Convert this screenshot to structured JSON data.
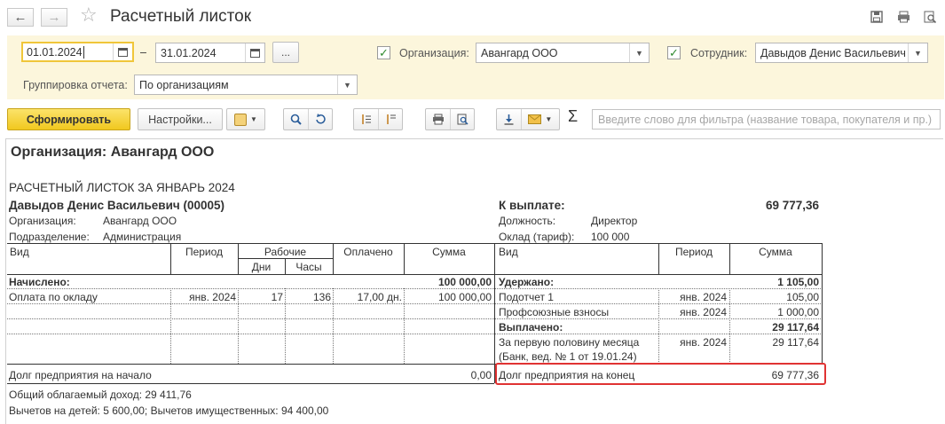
{
  "window": {
    "title": "Расчетный листок",
    "nav_back_icon": "arrow-left-icon",
    "nav_forward_icon": "arrow-right-icon",
    "favorite_icon": "star-icon"
  },
  "filters": {
    "date_from": "01.01.2024",
    "date_separator": "–",
    "date_to": "31.01.2024",
    "period_button": "...",
    "organization_label": "Организация:",
    "organization_value": "Авангард ООО",
    "employee_label": "Сотрудник:",
    "employee_value": "Давыдов Денис Васильевич",
    "grouping_label": "Группировка отчета:",
    "grouping_value": "По организациям"
  },
  "toolbar": {
    "generate": "Сформировать",
    "settings": "Настройки...",
    "search_placeholder": "Введите слово для фильтра (название товара, покупателя и пр.)",
    "sigma": "Σ"
  },
  "report": {
    "org_heading": "Организация: Авангард ООО",
    "sheet_title": "РАСЧЕТНЫЙ ЛИСТОК ЗА ЯНВАРЬ 2024",
    "employee": "Давыдов Денис Васильевич (00005)",
    "org_label": "Организация:",
    "org_value": "Авангард ООО",
    "dept_label": "Подразделение:",
    "dept_value": "Администрация",
    "to_pay_label": "К выплате:",
    "to_pay_value": "69 777,36",
    "position_label": "Должность:",
    "position_value": "Директор",
    "salary_label": "Оклад (тариф):",
    "salary_value": "100 000",
    "left_headers": {
      "kind": "Вид",
      "period": "Период",
      "worked": "Рабочие",
      "days": "Дни",
      "hours": "Часы",
      "paid": "Оплачено",
      "sum": "Сумма"
    },
    "right_headers": {
      "kind": "Вид",
      "period": "Период",
      "sum": "Сумма"
    },
    "accrued_label": "Начислено:",
    "accrued_total": "100 000,00",
    "accrual_rows": [
      {
        "kind": "Оплата по окладу",
        "period": "янв. 2024",
        "days": "17",
        "hours": "136",
        "paid": "17,00 дн.",
        "sum": "100 000,00"
      }
    ],
    "withheld_label": "Удержано:",
    "withheld_total": "1 105,00",
    "withheld_rows": [
      {
        "kind": "Подотчет 1",
        "period": "янв. 2024",
        "sum": "105,00"
      },
      {
        "kind": "Профсоюзные взносы",
        "period": "янв. 2024",
        "sum": "1 000,00"
      }
    ],
    "paid_label": "Выплачено:",
    "paid_total": "29 117,64",
    "paid_rows": [
      {
        "kind_line1": "За первую половину месяца",
        "kind_line2": "(Банк, вед. № 1 от 19.01.24)",
        "period": "янв. 2024",
        "sum": "29 117,64"
      }
    ],
    "debt_start_label": "Долг предприятия на начало",
    "debt_start_value": "0,00",
    "debt_end_label": "Долг предприятия на конец",
    "debt_end_value": "69 777,36",
    "taxable_income": "Общий облагаемый доход: 29 411,76",
    "deductions": "Вычетов на детей: 5 600,00; Вычетов имущественных: 94 400,00"
  }
}
